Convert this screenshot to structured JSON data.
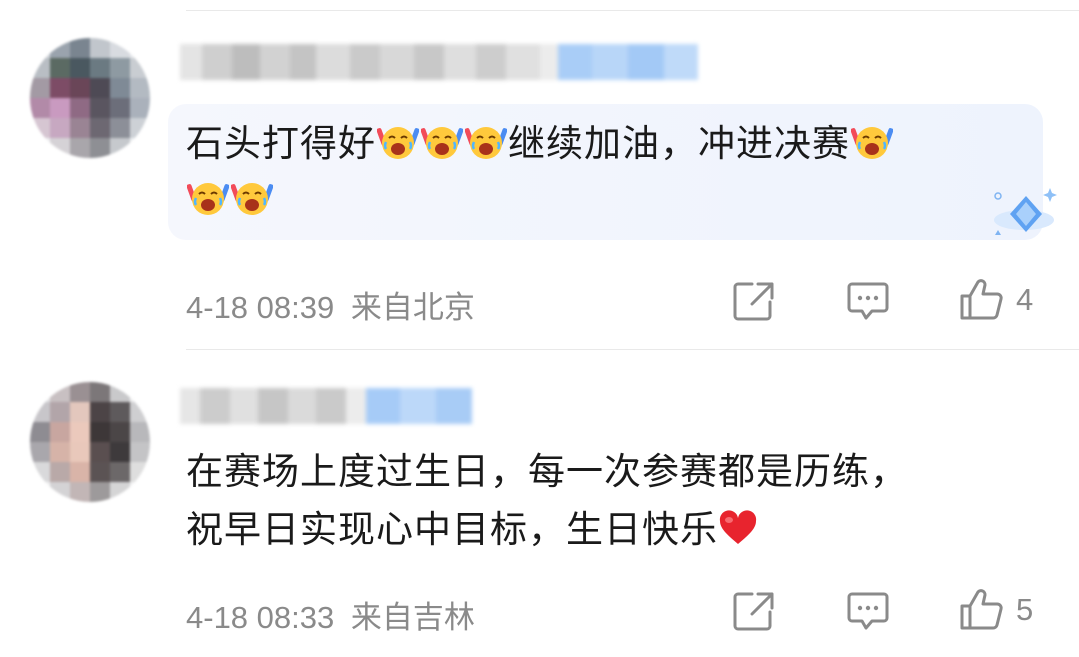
{
  "comments": [
    {
      "text_line1": "石头打得好",
      "text_line1_after": "继续加油，冲进决赛",
      "time": "4-18 08:39",
      "location": "来自北京",
      "likes": "4"
    },
    {
      "text_line1": "在赛场上度过生日，每一次参赛都是历练，",
      "text_line2": "祝早日实现心中目标，生日快乐",
      "time": "4-18 08:33",
      "location": "来自吉林",
      "likes": "5"
    }
  ],
  "icons": {
    "share": "share-icon",
    "comment": "comment-icon",
    "like": "thumbs-up-icon",
    "emoji": "laughing-cheer-emoji",
    "heart": "red-heart-emoji",
    "badge": "diamond-badge-icon"
  },
  "colors": {
    "meta": "#8a8a8a",
    "bubble": "#eef3fd",
    "heart": "#e8242e"
  }
}
